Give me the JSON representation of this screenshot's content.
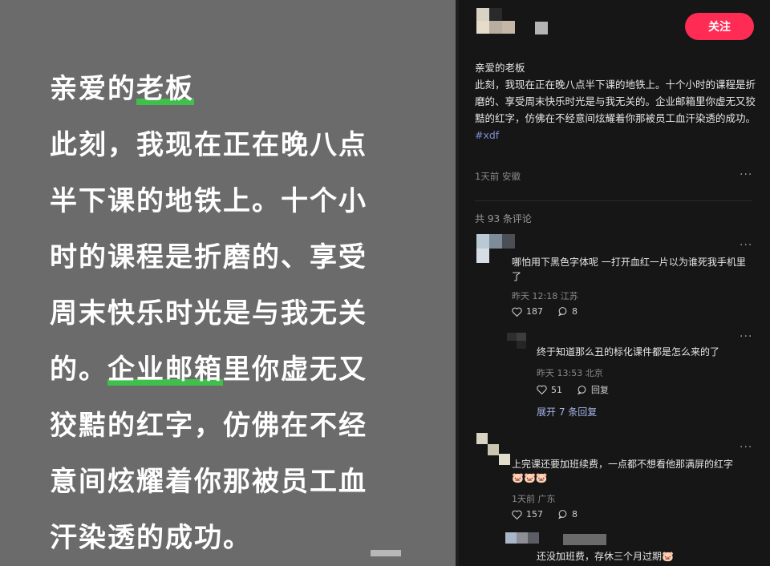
{
  "note_image": {
    "lines": [
      [
        {
          "t": "亲爱的"
        },
        {
          "t": "老板",
          "hl": true
        }
      ],
      [
        {
          "t": "此刻，我现在正在晚八点"
        }
      ],
      [
        {
          "t": "半下课的地铁上。十个小"
        }
      ],
      [
        {
          "t": "时的课程是折磨的、享受"
        }
      ],
      [
        {
          "t": "周末快乐时光是与我无关"
        }
      ],
      [
        {
          "t": "的。"
        },
        {
          "t": "企业邮箱",
          "hl": true
        },
        {
          "t": "里你虚无又"
        }
      ],
      [
        {
          "t": "狡黠的红字，仿佛在不经"
        }
      ],
      [
        {
          "t": "意间炫耀着你那被员工血"
        }
      ],
      [
        {
          "t": "汗染透的成功。"
        }
      ]
    ]
  },
  "post": {
    "follow_label": "关注",
    "greeting": "亲爱的老板",
    "body": "此刻，我现在正在晚八点半下课的地铁上。十个小时的课程是折磨的、享受周末快乐时光是与我无关的。企业邮箱里你虚无又狡黠的红字，仿佛在不经意间炫耀着你那被员工血汗染透的成功。",
    "hashtag": "#xdf",
    "meta": "1天前 安徽",
    "more": "···"
  },
  "comments": {
    "count_label": "共 93 条评论",
    "items": [
      {
        "text": "哪怕用下黑色字体呢 一打开血红一片以为谁死我手机里了",
        "meta": "昨天 12:18 江苏",
        "likes": "187",
        "replies": "8",
        "more": "···"
      },
      {
        "text": "终于知道那么丑的标化课件都是怎么来的了",
        "meta": "昨天 13:53 北京",
        "likes": "51",
        "reply_label": "回复",
        "more": "···"
      },
      {
        "text": "上完课还要加班续费，一点都不想看他那满屏的红字",
        "emoji": "🐷🐷🐷",
        "meta": "1天前 广东",
        "likes": "157",
        "replies": "8",
        "more": "···"
      },
      {
        "text": "还没加班费，存休三个月过期🐷"
      }
    ],
    "expand_label": "展开 7 条回复"
  },
  "colors": {
    "accent": "#fe2c55",
    "highlight": "#3fc04a",
    "hashtag": "#7d8fd4",
    "link": "#a8b4e8",
    "left_bg": "#6b6b6b",
    "right_bg": "#161616"
  }
}
